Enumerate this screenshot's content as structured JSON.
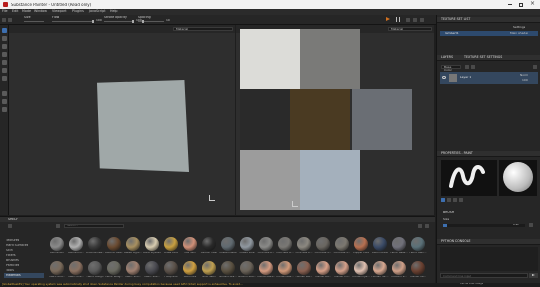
{
  "app": {
    "title": "Substance Painter - Untitled (Read only)"
  },
  "menu": [
    "File",
    "Edit",
    "Mode",
    "Window",
    "Viewport",
    "Plugins",
    "JavaScript",
    "Help"
  ],
  "toolbar": {
    "size_label": "Size",
    "size_value": "",
    "flow_label": "Flow",
    "flow_value": "100",
    "stroke_opacity_label": "Stroke opacity",
    "stroke_opacity_value": "100",
    "spacing_label": "Spacing",
    "spacing_value": "10"
  },
  "viewport3d": {
    "mode": "Material"
  },
  "viewport2d": {
    "mode": "Material"
  },
  "texture_set_list": {
    "title": "TEXTURE SET LIST",
    "settings": "Settings",
    "item_name": "lambert1",
    "item_shader": "Main shader"
  },
  "layers": {
    "tab_layers": "LAYERS",
    "tab_settings": "TEXTURE SET SETTINGS",
    "channel": "Base Color",
    "layer_name": "Layer 1",
    "blend_mode": "Norm",
    "opacity": "100"
  },
  "properties": {
    "title": "PROPERTIES - PAINT",
    "brush_label": "BRUSH",
    "size_label": "Size",
    "size_value": "0.92"
  },
  "python_console": {
    "title": "PYTHON CONSOLE",
    "placeholder": "Command line input"
  },
  "shelf": {
    "title": "SHELF",
    "search_placeholder": "Search...",
    "categories": [
      "Textures",
      "Hard Surfaces",
      "Skin",
      "Filters",
      "Brushes",
      "Particles",
      "Tools",
      "Materials"
    ],
    "row1": [
      "Aluminium",
      "Aluminum...",
      "Artificial Lea...",
      "Autumn Leaf...",
      "Baked Light...",
      "Bone Stylized",
      "Brass Pure",
      "Calf Skin",
      "Carbon Fiber",
      "Coated Metal",
      "Cobalt Pure",
      "Concrete B...",
      "Concrete Cl...",
      "Concrete D...",
      "Concrete S...",
      "Concrete S...",
      "Copper Pure",
      "Denim Rivet",
      "Fabric Base...",
      "Fabric Bam..."
    ],
    "row2": [
      "Fabric Rou...",
      "Fabric Knit...",
      "Fabric Rough",
      "Fabric Roug...",
      "Fabric Soft...",
      "Fabric Suit...",
      "Footprints",
      "Gold Pure",
      "Gold Satin",
      "Ground Gra...",
      "Ground Ston...",
      "Human Back...",
      "Human Bell...",
      "Human Bla...",
      "Human Bu...",
      "Human Ch...",
      "Human Eye...",
      "Human Fac...",
      "Human Fe...",
      "Human He..."
    ],
    "row1_colors": [
      "#8a8a8a",
      "#b0b0b0",
      "#3a3a3a",
      "#6a4a30",
      "#a89060",
      "#d8ccb0",
      "#c8a040",
      "#d09078",
      "#2a2a2a",
      "#606a70",
      "#9098a0",
      "#8a8a88",
      "#7a7874",
      "#8c8880",
      "#6a6660",
      "#7c7870",
      "#b87050",
      "#3a4a66",
      "#70707a",
      "#5a7078"
    ],
    "row2_colors": [
      "#7a6a5a",
      "#8a7060",
      "#5a5a5a",
      "#6a6a60",
      "#a08070",
      "#4a4a50",
      "#5a5048",
      "#d0a040",
      "#c0a050",
      "#5a5040",
      "#6a6258",
      "#d49a80",
      "#d09878",
      "#8a6050",
      "#d8a088",
      "#d4a08a",
      "#e0c0b0",
      "#d8a890",
      "#d0a088",
      "#6a4030"
    ]
  },
  "status": {
    "message": "[GlobalDeskEx] Your operating system was automatically shut down Substance Painter during busy computation because used GPU (Intel) support is exhaustive. To avoid...",
    "right": "Cache Disk Usage",
    "version": "Shelf: 0 items / 1"
  },
  "colors": {
    "accent": "#3d6fb0",
    "status_warning": "#e0b040",
    "panel": "#262626",
    "viewport": "#2e2e2e"
  },
  "uv_tiles": [
    "#dcdcd8",
    "#7a7a78",
    "#2a2a2a",
    "#4a3a22",
    "#6a6e74",
    "#9c9c9c",
    "#a4b0bc"
  ],
  "icons": [
    "window-logo-icon",
    "minimize-icon",
    "maximize-icon",
    "close-icon",
    "brush-icon",
    "eraser-icon",
    "projection-icon",
    "smudge-icon",
    "clone-icon",
    "picker-icon",
    "fill-icon",
    "polygon-fill-icon",
    "play-icon",
    "pause-icon",
    "camera-icon",
    "grid-icon",
    "eye-icon",
    "filter-icon",
    "search-icon",
    "gear-icon"
  ]
}
